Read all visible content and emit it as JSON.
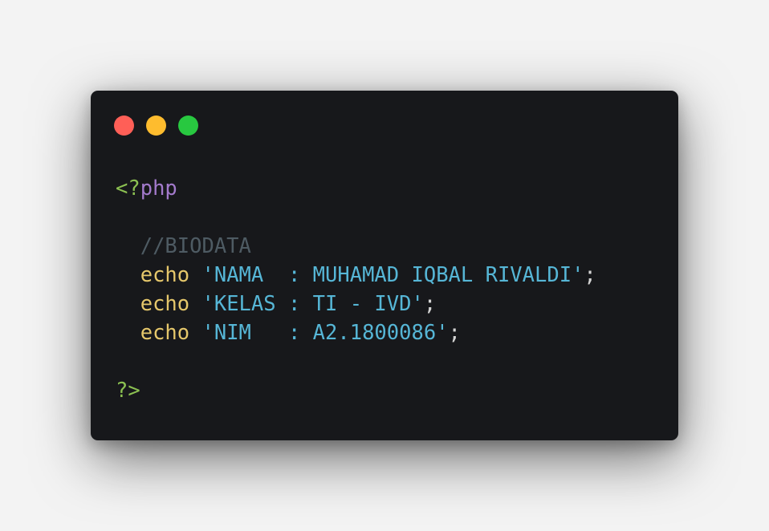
{
  "window": {
    "controls": [
      {
        "name": "close",
        "color": "#ff5f57"
      },
      {
        "name": "minimize",
        "color": "#febc2e"
      },
      {
        "name": "maximize",
        "color": "#28c840"
      }
    ]
  },
  "code": {
    "open_tag": "<?",
    "open_tag_php": "php",
    "comment": "//BIODATA",
    "lines": [
      {
        "keyword": "echo",
        "string": "'NAMA  : MUHAMAD IQBAL RIVALDI'",
        "end": ";"
      },
      {
        "keyword": "echo",
        "string": "'KELAS : TI - IVD'",
        "end": ";"
      },
      {
        "keyword": "echo",
        "string": "'NIM   : A2.1800086'",
        "end": ";"
      }
    ],
    "close_tag": "?>"
  },
  "colors": {
    "background": "#17181b",
    "tag": "#8cc152",
    "php": "#a37acc",
    "comment": "#4e5b63",
    "keyword": "#e5c76b",
    "string": "#56b6d6"
  }
}
